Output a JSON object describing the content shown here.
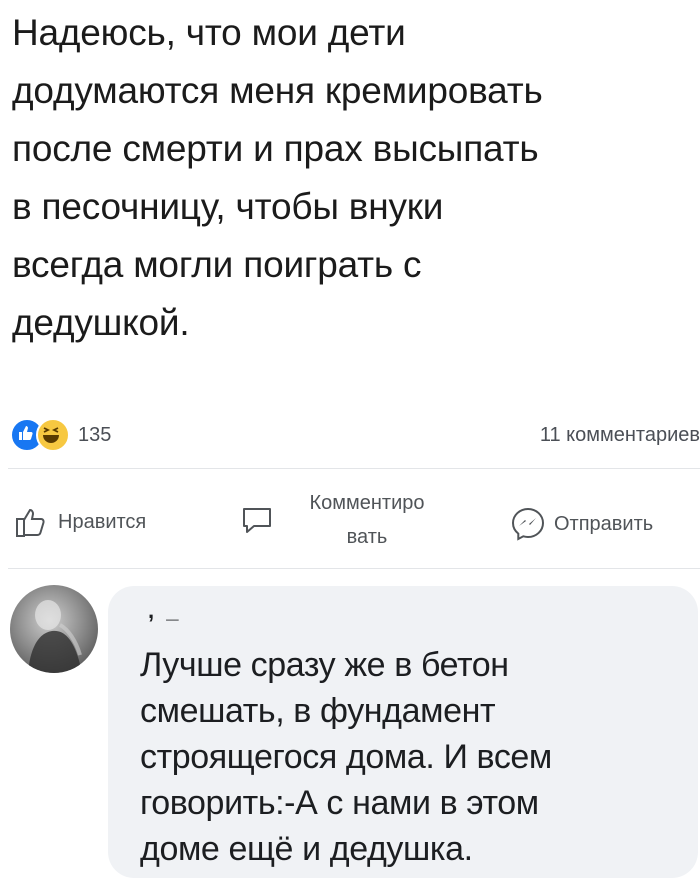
{
  "post": {
    "text": "Надеюсь, что мои дети\nдодумаются меня кремировать\nпосле смерти и прах высыпать\nв песочницу, чтобы внуки\nвсегда могли поиграть с\nдедушкой."
  },
  "stats": {
    "reaction_icons": [
      "like-icon",
      "haha-icon"
    ],
    "reaction_count": "135",
    "comments": "11 комментариев"
  },
  "actions": {
    "like": "Нравится",
    "comment": "Комментиро\nвать",
    "share": "Отправить"
  },
  "comment": {
    "author": ", _",
    "text": "Лучше сразу же в бетон\nсмешать, в фундамент\nстроящегося дома. И всем\nговорить:-А с нами в этом\nдоме ещё и дедушка."
  },
  "colors": {
    "like": "#1877f2",
    "haha": "#f7c841",
    "bubble": "#f0f2f5"
  }
}
